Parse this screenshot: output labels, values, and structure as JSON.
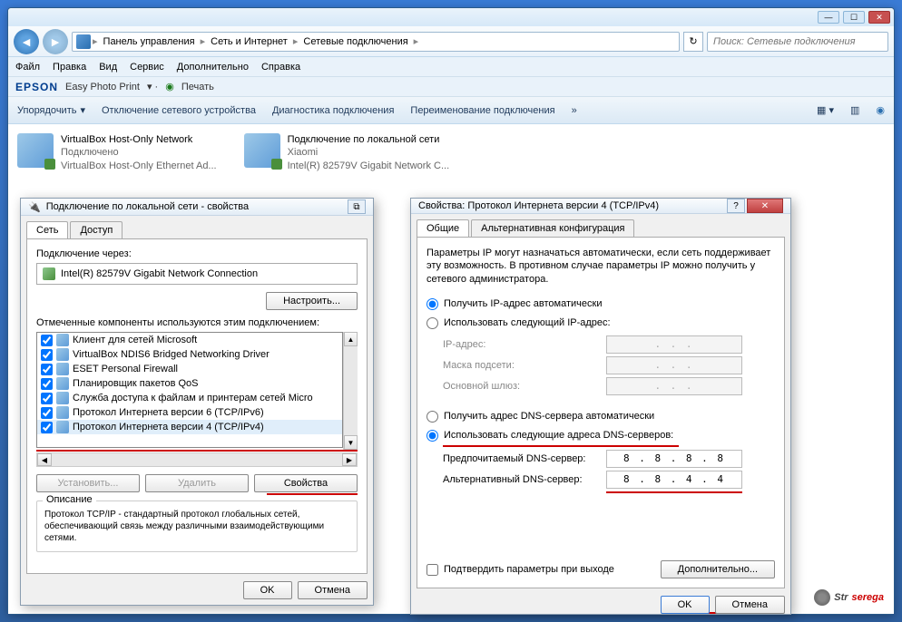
{
  "breadcrumb": {
    "items": [
      "Панель управления",
      "Сеть и Интернет",
      "Сетевые подключения"
    ]
  },
  "search": {
    "placeholder": "Поиск: Сетевые подключения"
  },
  "menus": [
    "Файл",
    "Правка",
    "Вид",
    "Сервис",
    "Дополнительно",
    "Справка"
  ],
  "epson": {
    "logo": "EPSON",
    "label": "Easy Photo Print",
    "print": "Печать"
  },
  "toolbar": {
    "organize": "Упорядочить",
    "disable": "Отключение сетевого устройства",
    "diag": "Диагностика подключения",
    "rename": "Переименование подключения"
  },
  "connections": [
    {
      "title": "VirtualBox Host-Only Network",
      "status": "Подключено",
      "device": "VirtualBox Host-Only Ethernet Ad..."
    },
    {
      "title": "Подключение по локальной сети",
      "status": "Xiaomi",
      "device": "Intel(R) 82579V Gigabit Network C..."
    }
  ],
  "props_dlg": {
    "title": "Подключение по локальной сети - свойства",
    "tab_net": "Сеть",
    "tab_access": "Доступ",
    "conn_via": "Подключение через:",
    "adapter": "Intel(R) 82579V Gigabit Network Connection",
    "configure": "Настроить...",
    "components_label": "Отмеченные компоненты используются этим подключением:",
    "components": [
      "Клиент для сетей Microsoft",
      "VirtualBox NDIS6 Bridged Networking Driver",
      "ESET Personal Firewall",
      "Планировщик пакетов QoS",
      "Служба доступа к файлам и принтерам сетей Micro",
      "Протокол Интернета версии 6 (TCP/IPv6)",
      "Протокол Интернета версии 4 (TCP/IPv4)"
    ],
    "install": "Установить...",
    "remove": "Удалить",
    "properties": "Свойства",
    "desc_title": "Описание",
    "desc_text": "Протокол TCP/IP - стандартный протокол глобальных сетей, обеспечивающий связь между различными взаимодействующими сетями.",
    "ok": "OK",
    "cancel": "Отмена"
  },
  "ipv4_dlg": {
    "title": "Свойства: Протокол Интернета версии 4 (TCP/IPv4)",
    "tab_general": "Общие",
    "tab_alt": "Альтернативная конфигурация",
    "intro": "Параметры IP могут назначаться автоматически, если сеть поддерживает эту возможность. В противном случае параметры IP можно получить у сетевого администратора.",
    "auto_ip": "Получить IP-адрес автоматически",
    "manual_ip": "Использовать следующий IP-адрес:",
    "ip_label": "IP-адрес:",
    "mask_label": "Маска подсети:",
    "gw_label": "Основной шлюз:",
    "auto_dns": "Получить адрес DNS-сервера автоматически",
    "manual_dns": "Использовать следующие адреса DNS-серверов:",
    "pref_dns": "Предпочитаемый DNS-сервер:",
    "alt_dns": "Альтернативный DNS-сервер:",
    "dns1": "8 . 8 . 8 . 8",
    "dns2": "8 . 8 . 4 . 4",
    "validate": "Подтвердить параметры при выходе",
    "advanced": "Дополнительно...",
    "ok": "OK",
    "cancel": "Отмена"
  },
  "watermark": "strserega"
}
